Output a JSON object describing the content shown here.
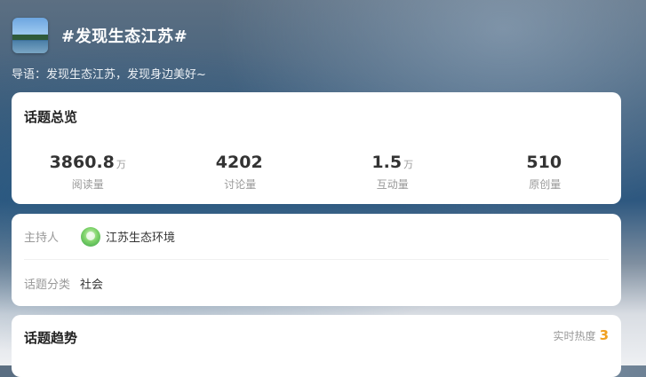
{
  "header": {
    "title": "#发现生态江苏#"
  },
  "intro": "导语：发现生态江苏，发现身边美好~",
  "overview": {
    "title": "话题总览",
    "stats": [
      {
        "value": "3860.8",
        "unit": "万",
        "label": "阅读量"
      },
      {
        "value": "4202",
        "unit": "",
        "label": "讨论量"
      },
      {
        "value": "1.5",
        "unit": "万",
        "label": "互动量"
      },
      {
        "value": "510",
        "unit": "",
        "label": "原创量"
      }
    ]
  },
  "info": {
    "host_label": "主持人",
    "host_name": "江苏生态环境",
    "category_label": "话题分类",
    "category_value": "社会"
  },
  "trend": {
    "title": "话题趋势",
    "heat_label": "实时热度",
    "heat_value": "3"
  },
  "colors": {
    "accent": "#f0a020",
    "card": "#ffffff",
    "muted": "#999999"
  },
  "icons": {
    "avatar": "topic-cover-image",
    "host": "host-avatar-icon"
  }
}
